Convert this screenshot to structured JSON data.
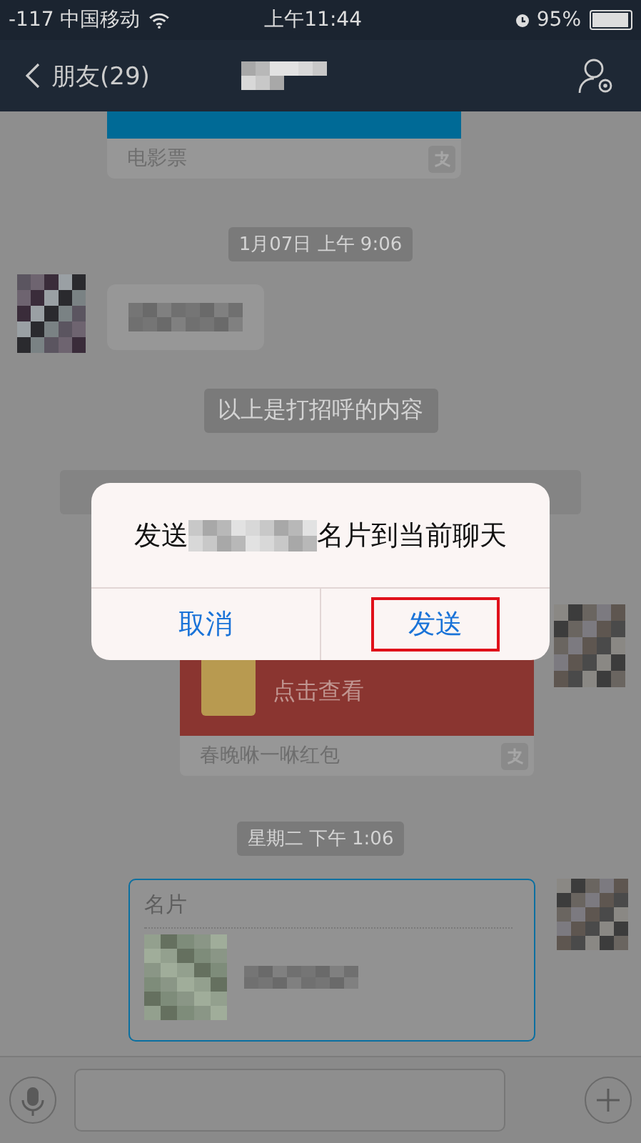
{
  "status_bar": {
    "signal": "-117",
    "carrier": "中国移动",
    "time": "上午11:44",
    "battery": "95%"
  },
  "nav": {
    "back": "朋友(29)"
  },
  "messages": [
    {
      "kind": "ticket_card",
      "label": "电影票"
    },
    {
      "kind": "time",
      "text": "1月07日 上午 9:06"
    },
    {
      "kind": "blurred"
    },
    {
      "kind": "notice",
      "text": "以上是打招呼的内容"
    },
    {
      "kind": "covered_notice"
    },
    {
      "kind": "red_packet",
      "action": "点击查看",
      "label": "春晚咻一咻红包"
    },
    {
      "kind": "time",
      "text": "星期二 下午 1:06"
    },
    {
      "kind": "contact_card",
      "title": "名片"
    }
  ],
  "dialog": {
    "title_start": "发送",
    "title_end": "名片到当前聊天",
    "buttons": [
      {
        "label": "取消",
        "highlighted": false
      },
      {
        "label": "发送",
        "highlighted": true
      }
    ]
  }
}
